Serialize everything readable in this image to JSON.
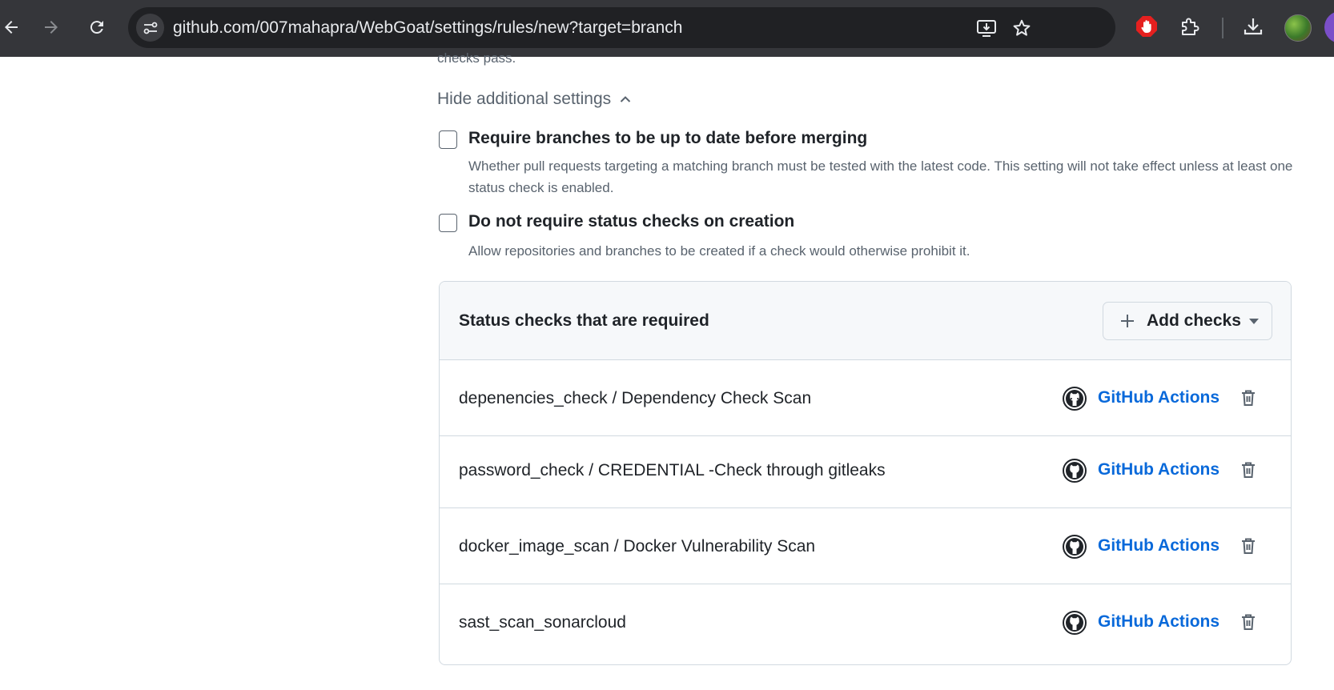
{
  "browser": {
    "url": "github.com/007mahapra/WebGoat/settings/rules/new?target=branch",
    "icons": [
      "back-arrow-icon",
      "forward-arrow-icon",
      "reload-icon",
      "site-info-icon",
      "install-app-icon",
      "bookmark-star-icon",
      "adblock-hand-icon",
      "extensions-puzzle-icon",
      "download-icon",
      "profile-avatar"
    ]
  },
  "page": {
    "truncated_text": "checks pass.",
    "toggle_label": "Hide additional settings",
    "options": [
      {
        "title": "Require branches to be up to date before merging",
        "description": "Whether pull requests targeting a matching branch must be tested with the latest code. This setting will not take effect unless at least one status check is enabled.",
        "checked": false
      },
      {
        "title": "Do not require status checks on creation",
        "description": "Allow repositories and branches to be created if a check would otherwise prohibit it.",
        "checked": false
      }
    ],
    "status_checks": {
      "title": "Status checks that are required",
      "add_button_label": "Add checks",
      "rows": [
        {
          "name": "depenencies_check / Dependency Check Scan",
          "app": "GitHub Actions"
        },
        {
          "name": "password_check / CREDENTIAL -Check through gitleaks",
          "app": "GitHub Actions"
        },
        {
          "name": "docker_image_scan / Docker Vulnerability Scan",
          "app": "GitHub Actions"
        },
        {
          "name": "sast_scan_sonarcloud",
          "app": "GitHub Actions"
        }
      ]
    }
  },
  "colors": {
    "link": "#0969da",
    "muted_text": "#59636e",
    "border": "#d1d9e0",
    "header_bg": "#f6f8fa",
    "chrome_bg": "#35363a",
    "adblock_red": "#e5201f"
  }
}
